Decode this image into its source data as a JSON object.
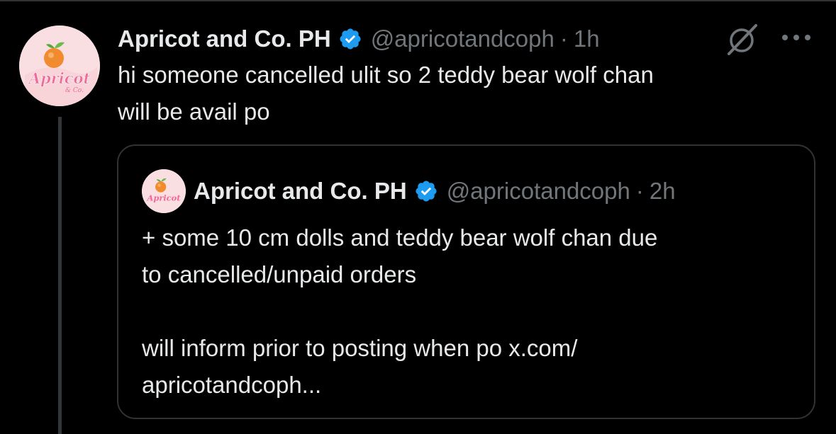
{
  "tweet": {
    "display_name": "Apricot and Co. PH",
    "handle": "@apricotandcoph",
    "separator": "·",
    "time": "1h",
    "text_lines": [
      "hi someone cancelled ulit so 2 teddy bear wolf chan",
      "will be avail po"
    ],
    "avatar_logo_text": "Apricot",
    "avatar_logo_sub": "& Co."
  },
  "quote": {
    "display_name": "Apricot and Co. PH",
    "handle": "@apricotandcoph",
    "separator": "·",
    "time": "2h",
    "text_lines": [
      "+ some 10 cm dolls and teddy bear wolf chan due",
      "to cancelled/unpaid orders",
      "",
      "will inform prior to posting when po x.com/",
      "apricotandcoph..."
    ]
  },
  "icons": {
    "verified": "verified-badge-icon",
    "grok": "grok-icon",
    "more": "more-icon"
  },
  "colors": {
    "background": "#000000",
    "primary_text": "#e7e9ea",
    "secondary_text": "#71767b",
    "border": "#2f3336",
    "verified_blue": "#1d9bf0",
    "avatar_bg": "#f9dfe2",
    "logo_pink": "#f06a9a",
    "apricot_orange": "#f28a2e"
  }
}
